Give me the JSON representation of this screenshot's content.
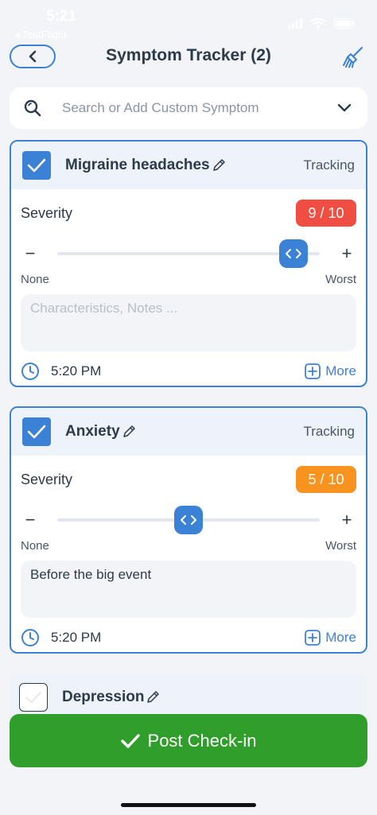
{
  "status_bar": {
    "time": "5:21",
    "back_label": "◂ TestFlight"
  },
  "header": {
    "title": "Symptom Tracker (2)"
  },
  "search": {
    "placeholder": "Search or Add Custom Symptom"
  },
  "common": {
    "severity_label": "Severity",
    "slider_min_label": "None",
    "slider_max_label": "Worst",
    "minus_label": "−",
    "plus_label": "+",
    "more_label": "More",
    "notes_placeholder": "Characteristics, Notes ..."
  },
  "symptoms": [
    {
      "name": "Migraine headaches",
      "status": "Tracking",
      "checked": true,
      "severity": 9,
      "severity_max": 10,
      "severity_text": "9 / 10",
      "badge_color": "#f04e43",
      "notes": "",
      "time": "5:20 PM"
    },
    {
      "name": "Anxiety",
      "status": "Tracking",
      "checked": true,
      "severity": 5,
      "severity_max": 10,
      "severity_text": "5 / 10",
      "badge_color": "#f7931e",
      "notes": "Before the big event",
      "time": "5:20 PM"
    },
    {
      "name": "Depression",
      "checked": false
    }
  ],
  "footer": {
    "post_label": "Post Check-in"
  },
  "colors": {
    "accent": "#3b82d6",
    "post_button": "#2f9e2a"
  },
  "icons": {
    "back": "chevron-left-icon",
    "clear": "broom-icon",
    "search": "search-icon",
    "dropdown": "chevron-down-icon",
    "checkbox": "checkmark-icon",
    "edit": "pencil-icon",
    "time": "clock-icon",
    "more": "plus-square-icon",
    "post": "checkmark-icon"
  }
}
